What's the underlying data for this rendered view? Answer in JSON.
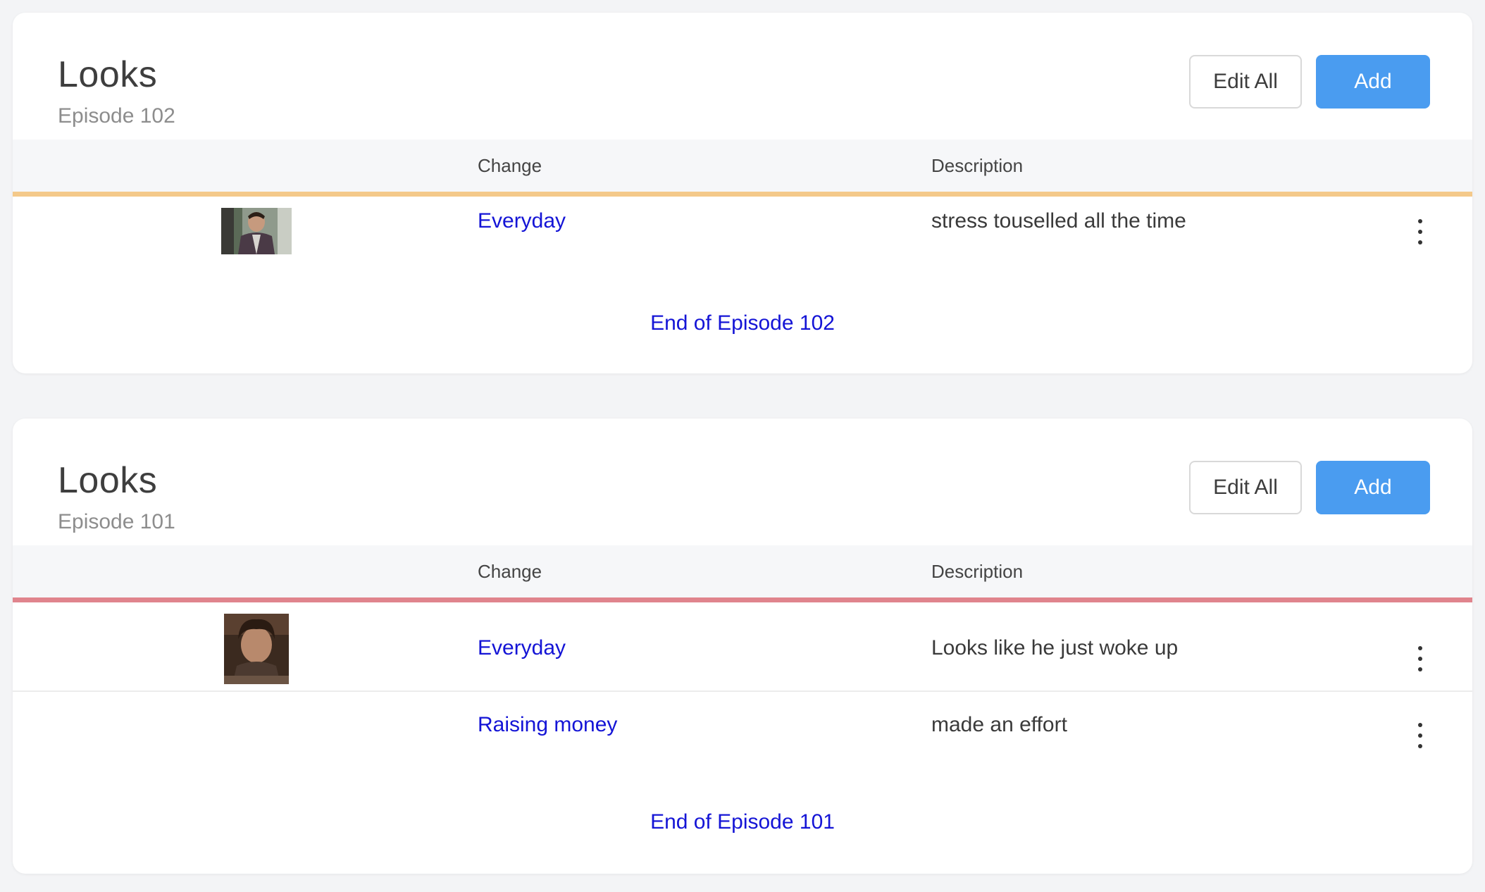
{
  "cards": [
    {
      "title": "Looks",
      "subtitle": "Episode 102",
      "edit_label": "Edit All",
      "add_label": "Add",
      "columns": {
        "change": "Change",
        "description": "Description"
      },
      "accent_color": "#f4c98a",
      "rows": [
        {
          "change": "Everyday",
          "description": "stress touselled all the time"
        }
      ],
      "footer": "End of Episode 102"
    },
    {
      "title": "Looks",
      "subtitle": "Episode 101",
      "edit_label": "Edit All",
      "add_label": "Add",
      "columns": {
        "change": "Change",
        "description": "Description"
      },
      "accent_color": "#e0848d",
      "rows": [
        {
          "change": "Everyday",
          "description": "Looks like he just woke up"
        },
        {
          "change": "Raising money",
          "description": "made an effort"
        }
      ],
      "footer": "End of Episode 101"
    }
  ],
  "colors": {
    "add_button": "#4a9cf0",
    "link": "#1414d6"
  }
}
